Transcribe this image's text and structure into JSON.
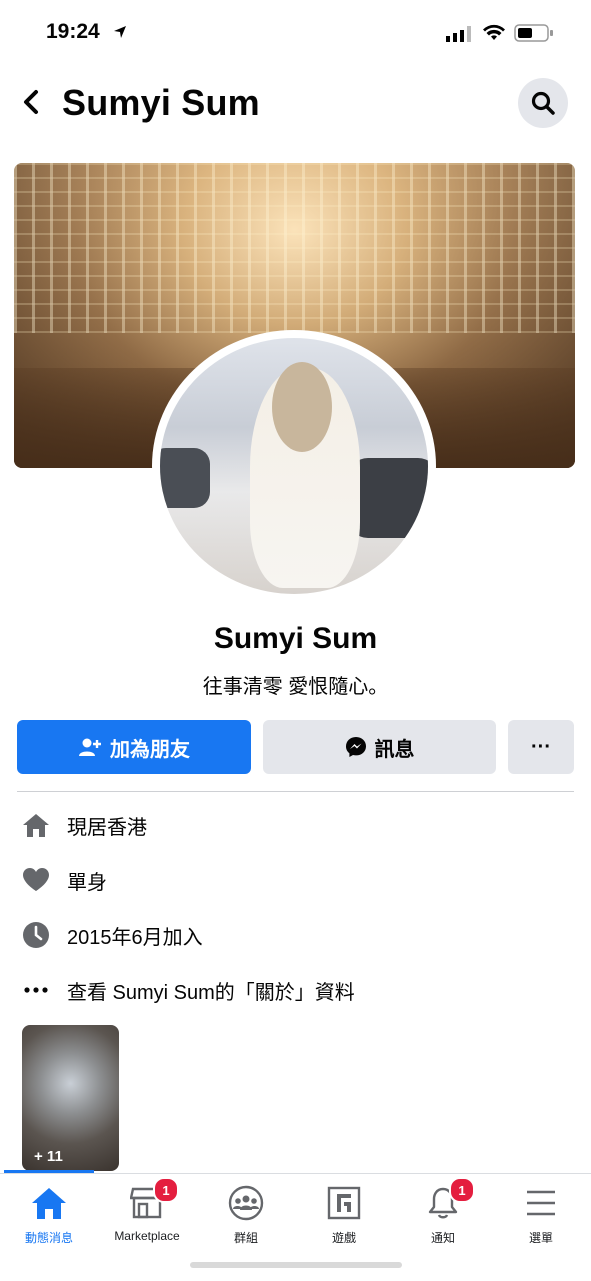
{
  "status_bar": {
    "time": "19:24"
  },
  "header": {
    "title": "Sumyi Sum"
  },
  "profile": {
    "name": "Sumyi Sum",
    "bio": "往事清零 愛恨隨心。"
  },
  "actions": {
    "add_friend": "加為朋友",
    "message": "訊息",
    "more": "···"
  },
  "details": [
    {
      "icon": "home-icon",
      "text": "現居香港"
    },
    {
      "icon": "heart-icon",
      "text": "單身"
    },
    {
      "icon": "clock-icon",
      "text": "2015年6月加入"
    },
    {
      "icon": "more-dots-icon",
      "text": "查看 Sumyi Sum的「關於」資料"
    }
  ],
  "photos": {
    "count_label": "+ 11"
  },
  "nav": [
    {
      "label": "動態消息",
      "icon": "home-icon",
      "active": true
    },
    {
      "label": "Marketplace",
      "icon": "marketplace-icon",
      "badge": "1"
    },
    {
      "label": "群組",
      "icon": "groups-icon"
    },
    {
      "label": "遊戲",
      "icon": "gaming-icon"
    },
    {
      "label": "通知",
      "icon": "bell-icon",
      "badge": "1"
    },
    {
      "label": "選單",
      "icon": "menu-icon"
    }
  ],
  "colors": {
    "accent": "#1877f2",
    "badge": "#e41e3f",
    "button_gray": "#e4e6eb"
  }
}
